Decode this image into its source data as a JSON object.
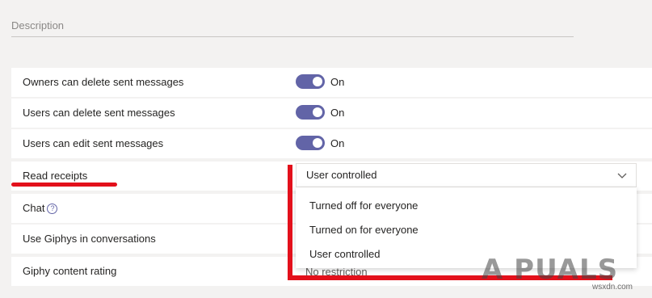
{
  "description_label": "Description",
  "rows": [
    {
      "label": "Owners can delete sent messages",
      "state": "On"
    },
    {
      "label": "Users can delete sent messages",
      "state": "On"
    },
    {
      "label": "Users can edit sent messages",
      "state": "On"
    },
    {
      "label": "Read receipts"
    },
    {
      "label": "Chat"
    },
    {
      "label": "Use Giphys in conversations"
    },
    {
      "label": "Giphy content rating"
    }
  ],
  "read_receipts_select": {
    "value": "User controlled",
    "options": [
      "Turned off for everyone",
      "Turned on for everyone",
      "User controlled"
    ]
  },
  "giphy_rating_partial": "No restriction",
  "watermark": {
    "logo": "A PUALS",
    "url": "wsxdn.com"
  },
  "colors": {
    "toggle_on": "#6264a7",
    "annotation_red": "#e3101b"
  },
  "icons": {
    "help": "question-circle-icon",
    "dropdown": "chevron-down-icon"
  }
}
